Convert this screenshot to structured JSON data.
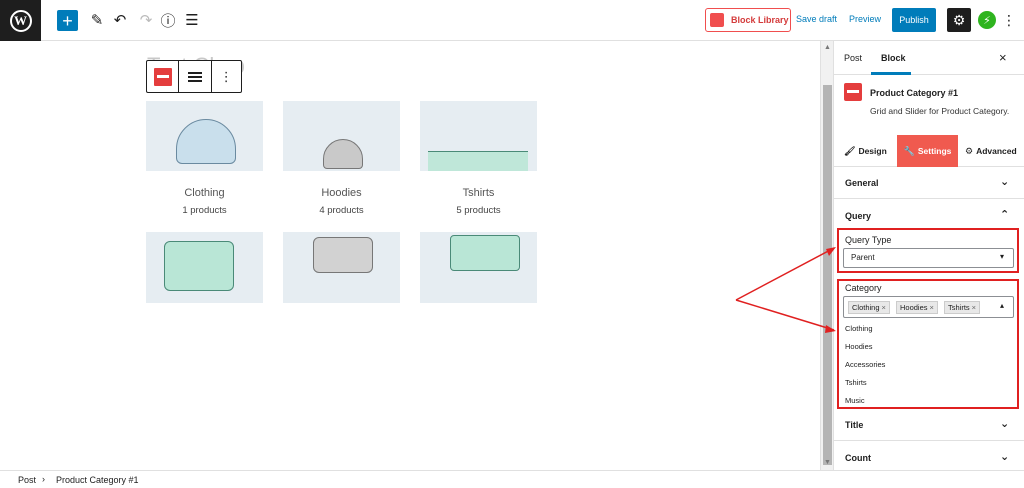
{
  "topbar": {
    "wp_logo_letter": "W",
    "add_symbol": "+",
    "block_library": "Block Library",
    "save_draft": "Save draft",
    "preview": "Preview",
    "publish": "Publish",
    "settings_symbol": "⚙",
    "kebab_symbol": "⋮"
  },
  "canvas": {
    "heading": "Text Clo p",
    "categories": [
      {
        "name": "Clothing",
        "count": "1 products"
      },
      {
        "name": "Hoodies",
        "count": "4 products"
      },
      {
        "name": "Tshirts",
        "count": "5 products"
      }
    ]
  },
  "sidebar": {
    "tabs": {
      "post": "Post",
      "block": "Block"
    },
    "close_symbol": "×",
    "block_title": "Product Category #1",
    "block_description": "Grid and Slider for Product Category.",
    "subtabs": {
      "design": "Design",
      "settings": "Settings",
      "advanced": "Advanced"
    },
    "panels": {
      "general": "General",
      "query": "Query",
      "title": "Title",
      "count": "Count"
    },
    "query_type_label": "Query Type",
    "query_type_value": "Parent",
    "category_label": "Category",
    "category_tokens": [
      "Clothing",
      "Hoodies",
      "Tshirts"
    ],
    "category_options": [
      "Clothing",
      "Hoodies",
      "Accessories",
      "Tshirts",
      "Music"
    ]
  },
  "footer": {
    "crumb_post": "Post",
    "crumb_sep": "›",
    "crumb_block": "Product Category #1"
  },
  "colors": {
    "accent": "#007cba",
    "highlight": "#e02020",
    "settings_tab": "#f05a4f"
  },
  "icons": [
    "wordpress-icon",
    "plus-icon",
    "pencil-icon",
    "undo-icon",
    "redo-icon",
    "info-icon",
    "list-view-icon",
    "gear-icon",
    "jetpack-icon",
    "more-icon",
    "close-icon",
    "chevron-down-icon",
    "chevron-up-icon"
  ]
}
